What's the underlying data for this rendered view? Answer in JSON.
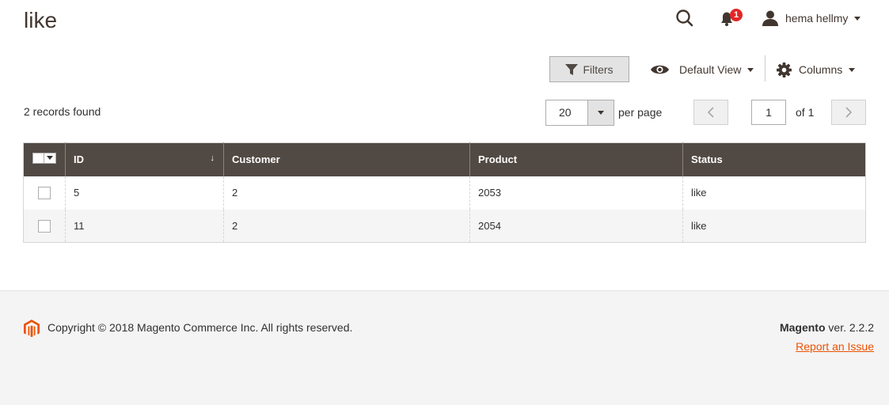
{
  "page": {
    "title": "like"
  },
  "header": {
    "notification_count": "1",
    "user_name": "hema hellmy"
  },
  "toolbar": {
    "filters_label": "Filters",
    "view_label": "Default View",
    "columns_label": "Columns"
  },
  "grid_info": {
    "records_found": "2 records found",
    "per_page_value": "20",
    "per_page_label": "per page",
    "current_page": "1",
    "of_pages": "of 1"
  },
  "table": {
    "columns": [
      "ID",
      "Customer",
      "Product",
      "Status"
    ],
    "sort_indicator": "↓",
    "rows": [
      {
        "id": "5",
        "customer": "2",
        "product": "2053",
        "status": "like"
      },
      {
        "id": "11",
        "customer": "2",
        "product": "2054",
        "status": "like"
      }
    ]
  },
  "footer": {
    "copyright": "Copyright © 2018 Magento Commerce Inc. All rights reserved.",
    "brand": "Magento",
    "version": " ver. 2.2.2",
    "report_link": "Report an Issue"
  },
  "colors": {
    "header_bg": "#514943",
    "accent": "#eb5202",
    "badge": "#e22626"
  },
  "icons": [
    "search-icon",
    "bell-icon",
    "user-icon",
    "filter-icon",
    "eye-icon",
    "gear-icon",
    "magento-logo-icon"
  ]
}
